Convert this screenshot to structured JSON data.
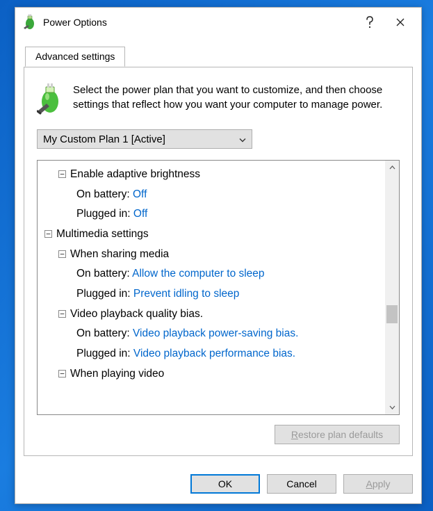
{
  "window": {
    "title": "Power Options",
    "help_tooltip": "?",
    "close_tooltip": "Close"
  },
  "tab": {
    "label": "Advanced settings"
  },
  "intro": "Select the power plan that you want to customize, and then choose settings that reflect how you want your computer to manage power.",
  "plan_selector": {
    "selected": "My Custom Plan 1 [Active]"
  },
  "tree": {
    "enable_adaptive_brightness": {
      "label": "Enable adaptive brightness",
      "on_battery_label": "On battery",
      "on_battery_value": "Off",
      "plugged_in_label": "Plugged in",
      "plugged_in_value": "Off"
    },
    "multimedia": {
      "label": "Multimedia settings",
      "sharing": {
        "label": "When sharing media",
        "on_battery_label": "On battery",
        "on_battery_value": "Allow the computer to sleep",
        "plugged_in_label": "Plugged in",
        "plugged_in_value": "Prevent idling to sleep"
      },
      "video_bias": {
        "label": "Video playback quality bias.",
        "on_battery_label": "On battery",
        "on_battery_value": "Video playback power-saving bias.",
        "plugged_in_label": "Plugged in",
        "plugged_in_value": "Video playback performance bias."
      },
      "playing_video": {
        "label": "When playing video"
      }
    }
  },
  "buttons": {
    "restore_prefix": "R",
    "restore_suffix": "estore plan defaults",
    "ok": "OK",
    "cancel": "Cancel",
    "apply_prefix": "A",
    "apply_suffix": "pply"
  }
}
